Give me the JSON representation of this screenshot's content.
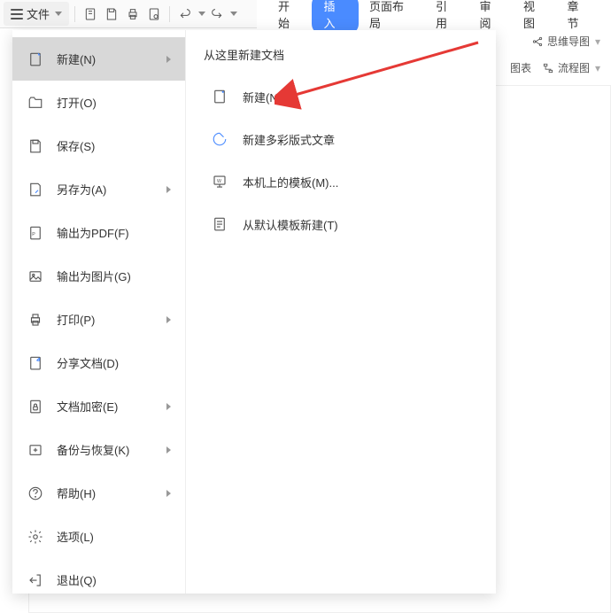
{
  "toolbar": {
    "file_label": "文件"
  },
  "tabs": {
    "start": "开始",
    "insert": "插入",
    "page_layout": "页面布局",
    "reference": "引用",
    "review": "审阅",
    "view": "视图",
    "chapter": "章节"
  },
  "right_extras": {
    "mindmap": "思维导图",
    "chart": "图表",
    "flowchart": "流程图"
  },
  "file_menu": {
    "items": [
      {
        "label": "新建(N)",
        "has_caret": true
      },
      {
        "label": "打开(O)",
        "has_caret": false
      },
      {
        "label": "保存(S)",
        "has_caret": false
      },
      {
        "label": "另存为(A)",
        "has_caret": true
      },
      {
        "label": "输出为PDF(F)",
        "has_caret": false
      },
      {
        "label": "输出为图片(G)",
        "has_caret": false
      },
      {
        "label": "打印(P)",
        "has_caret": true
      },
      {
        "label": "分享文档(D)",
        "has_caret": false
      },
      {
        "label": "文档加密(E)",
        "has_caret": true
      },
      {
        "label": "备份与恢复(K)",
        "has_caret": true
      },
      {
        "label": "帮助(H)",
        "has_caret": true
      },
      {
        "label": "选项(L)",
        "has_caret": false
      },
      {
        "label": "退出(Q)",
        "has_caret": false
      }
    ]
  },
  "submenu": {
    "title": "从这里新建文档",
    "items": [
      {
        "label": "新建(N)"
      },
      {
        "label": "新建多彩版式文章"
      },
      {
        "label": "本机上的模板(M)..."
      },
      {
        "label": "从默认模板新建(T)"
      }
    ]
  },
  "annotation": {
    "arrow_color": "#e53935"
  }
}
